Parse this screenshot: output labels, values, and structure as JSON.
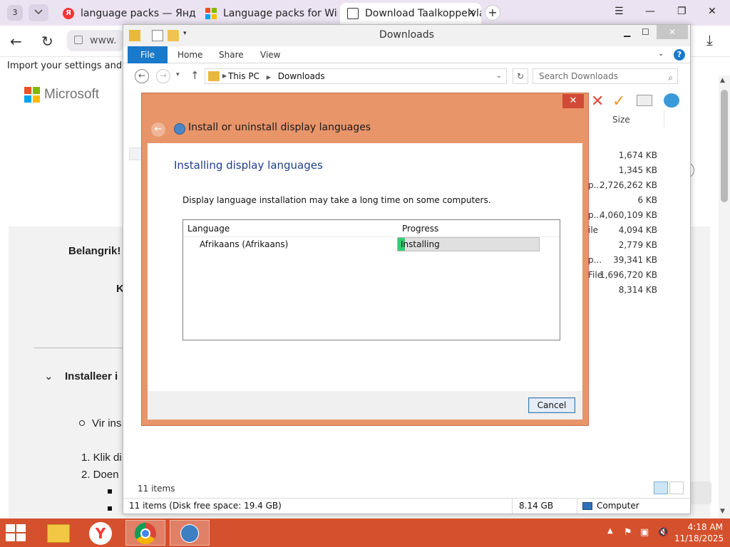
{
  "browser": {
    "tab_count": "3",
    "tabs": [
      {
        "label": "language packs — Яндекс",
        "active": false,
        "favicon": "yandex-icon"
      },
      {
        "label": "Language packs for Windo",
        "active": false,
        "favicon": "microsoft-icon"
      },
      {
        "label": "Download Taalkoppelvla",
        "active": true,
        "favicon": "document-icon"
      }
    ],
    "address_text": "www.",
    "import_bar_text": "Import your settings and bo"
  },
  "page": {
    "brand": "Microsoft",
    "important_label": "Belangrik!",
    "k_fragment": "K",
    "section_heading": "Installeer i",
    "bullet_text": "Vir ins",
    "step1": "1. Klik di",
    "step2": "2. Doen"
  },
  "explorer": {
    "title": "Downloads",
    "ribbon_tabs": [
      "File",
      "Home",
      "Share",
      "View"
    ],
    "breadcrumb": [
      "This PC",
      "Downloads"
    ],
    "search_placeholder": "Search Downloads",
    "size_header": "Size",
    "sizes": [
      "1,674 KB",
      "1,345 KB",
      "2,726,262 KB",
      "6 KB",
      "4,060,109 KB",
      "4,094 KB",
      "2,779 KB",
      "39,341 KB",
      "1,696,720 KB",
      "8,314 KB"
    ],
    "type_fragments": [
      "p...",
      "p...",
      "ile",
      "p...",
      "File"
    ],
    "items_count": "11 items",
    "status_left": "11 items (Disk free space: 19.4 GB)",
    "status_size": "8.14 GB",
    "status_location": "Computer"
  },
  "dialog": {
    "window_title": "Install or uninstall display languages",
    "heading": "Installing display languages",
    "note": "Display language installation may take a long time on some computers.",
    "col_language": "Language",
    "col_progress": "Progress",
    "row_language": "Afrikaans (Afrikaans)",
    "row_status": "Installing",
    "row_progress_fraction": 0.05,
    "cancel_label": "Cancel",
    "accent_color": "#e8956a"
  },
  "taskbar": {
    "time": "4:18 AM",
    "date": "11/18/2025",
    "color": "#d5502c"
  }
}
